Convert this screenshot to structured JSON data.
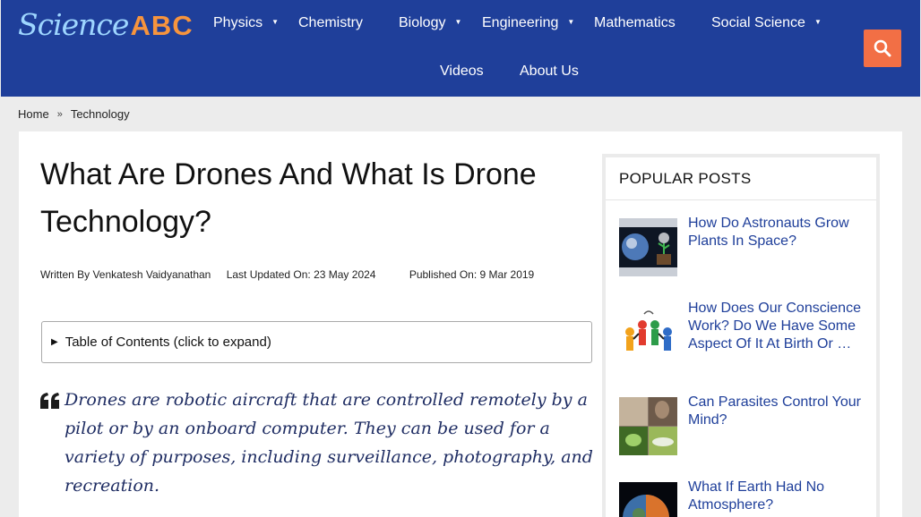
{
  "logo": {
    "part1": "Science",
    "part2": "ABC"
  },
  "nav": {
    "items": [
      {
        "label": "Physics",
        "caret": "▼"
      },
      {
        "label": "Chemistry",
        "caret": ""
      },
      {
        "label": "Biology",
        "caret": "▼"
      },
      {
        "label": "Engineering",
        "caret": "▼"
      },
      {
        "label": "Mathematics",
        "caret": ""
      },
      {
        "label": "Social Science",
        "caret": "▼"
      },
      {
        "label": "Videos",
        "caret": ""
      },
      {
        "label": "About Us",
        "caret": ""
      }
    ],
    "search_icon": "search-icon"
  },
  "breadcrumb": {
    "home": "Home",
    "separator": "»",
    "current": "Technology"
  },
  "article": {
    "title": "What Are Drones And What Is Drone Technology?",
    "written_by": "Written By Venkatesh Vaidyanathan",
    "last_updated": "Last Updated On: 23 May 2024",
    "published": "Published On: 9 Mar 2019",
    "toc_label": "Table of Contents (click to expand)",
    "toc_arrow": "▶",
    "quote": "Drones are robotic aircraft that are controlled remotely by a pilot or by an onboard computer. They can be used for a variety of purposes, including surveillance, photography, and recreation."
  },
  "sidebar": {
    "heading": "POPULAR POSTS",
    "posts": [
      {
        "title": "How Do Astronauts Grow Plants In Space?"
      },
      {
        "title": "How Does Our Conscience Work? Do We Have Some Aspect Of It At Birth Or …"
      },
      {
        "title": "Can Parasites Control Your Mind?"
      },
      {
        "title": "What If Earth Had No Atmosphere?"
      }
    ]
  },
  "colors": {
    "brand_blue": "#1f3f9a",
    "accent_orange": "#f26f45",
    "logo_light": "#9ed6ff",
    "quote_text": "#1f2d63"
  }
}
